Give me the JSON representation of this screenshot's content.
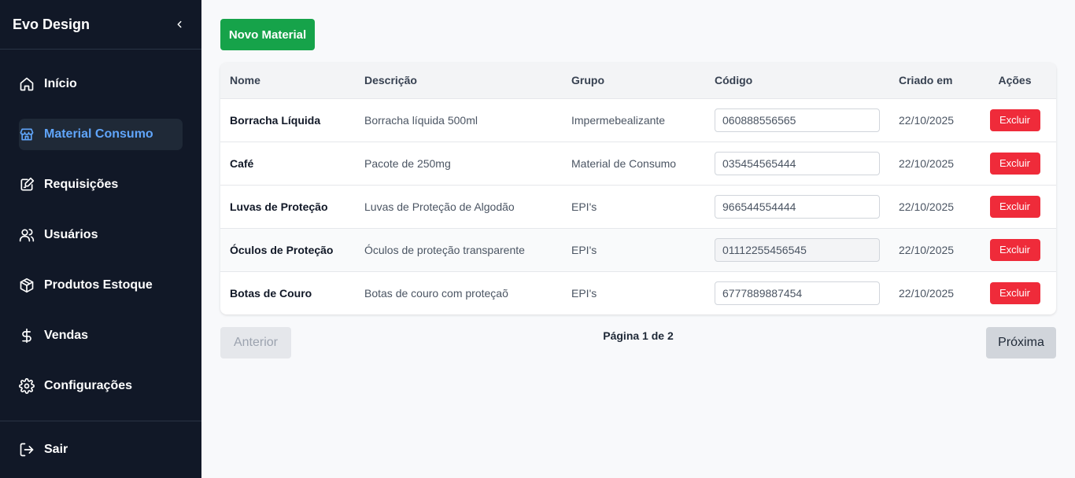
{
  "app": {
    "brand": "Evo Design"
  },
  "sidebar": {
    "items": [
      {
        "label": "Início",
        "icon": "home-icon"
      },
      {
        "label": "Material Consumo",
        "icon": "store-icon",
        "active": true
      },
      {
        "label": "Requisições",
        "icon": "clipboard-edit-icon"
      },
      {
        "label": "Usuários",
        "icon": "users-icon"
      },
      {
        "label": "Produtos Estoque",
        "icon": "package-icon"
      },
      {
        "label": "Vendas",
        "icon": "dollar-icon"
      },
      {
        "label": "Configurações",
        "icon": "gear-icon"
      }
    ],
    "logout": {
      "label": "Sair",
      "icon": "logout-icon"
    }
  },
  "toolbar": {
    "new_label": "Novo Material"
  },
  "table": {
    "headers": {
      "name": "Nome",
      "description": "Descrição",
      "group": "Grupo",
      "code": "Código",
      "created": "Criado em",
      "actions": "Ações"
    },
    "rows": [
      {
        "name": "Borracha Líquida",
        "description": "Borracha líquida 500ml",
        "group": "Impermebealizante",
        "code": "060888556565",
        "created": "22/10/2025",
        "action": "Excluir"
      },
      {
        "name": "Café",
        "description": "Pacote de 250mg",
        "group": "Material de Consumo",
        "code": "035454565444",
        "created": "22/10/2025",
        "action": "Excluir"
      },
      {
        "name": "Luvas de Proteção",
        "description": "Luvas de Proteção de Algodão",
        "group": "EPI's",
        "code": "966544554444",
        "created": "22/10/2025",
        "action": "Excluir"
      },
      {
        "name": "Óculos de Proteção",
        "description": "Óculos de proteção transparente",
        "group": "EPI's",
        "code": "01112255456545",
        "created": "22/10/2025",
        "action": "Excluir"
      },
      {
        "name": "Botas de Couro",
        "description": "Botas de couro com proteçaõ",
        "group": "EPI's",
        "code": "6777889887454",
        "created": "22/10/2025",
        "action": "Excluir"
      }
    ]
  },
  "pagination": {
    "prev_label": "Anterior",
    "info": "Página 1 de 2",
    "next_label": "Próxima"
  },
  "colors": {
    "sidebar_bg": "#111827",
    "active_item_bg": "#1f2937",
    "active_text": "#60a5fa",
    "primary_green": "#16a34a",
    "danger_red": "#ef2b3a"
  }
}
